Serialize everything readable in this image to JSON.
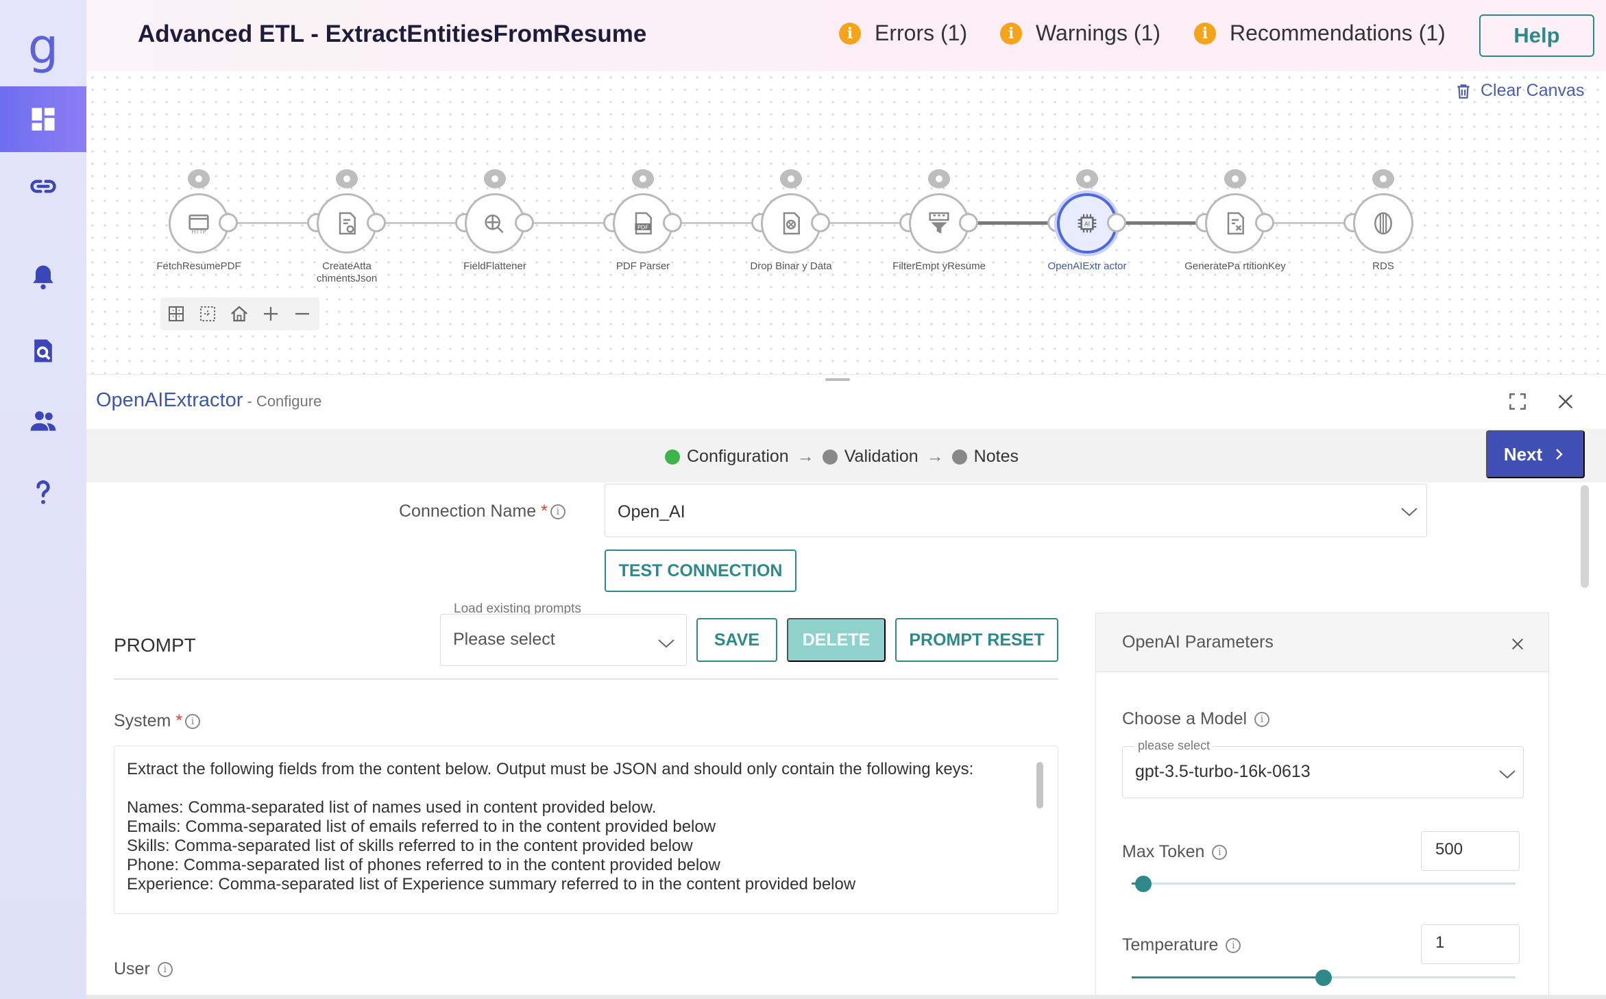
{
  "app": {
    "logo_letter": "g",
    "title": "Advanced ETL - ExtractEntitiesFromResume"
  },
  "sidebar": {
    "items": [
      {
        "icon": "dashboard-icon",
        "active": true
      },
      {
        "icon": "link-icon",
        "active": false
      },
      {
        "icon": "bell-icon",
        "active": false
      },
      {
        "icon": "search-document-icon",
        "active": false
      },
      {
        "icon": "users-icon",
        "active": false
      },
      {
        "icon": "question-icon",
        "active": false
      }
    ]
  },
  "header": {
    "errors": "Errors (1)",
    "warnings": "Warnings (1)",
    "recommendations": "Recommendations (1)",
    "help_label": "Help",
    "issue_icon_glyph": "i"
  },
  "canvas": {
    "clear_label": "Clear Canvas",
    "nodes": [
      {
        "label": "FetchResumePDF",
        "icon": "http-icon"
      },
      {
        "label": "CreateAtta chmentsJson",
        "icon": "document-gear-icon"
      },
      {
        "label": "FieldFlattener",
        "icon": "flatten-icon"
      },
      {
        "label": "PDF Parser",
        "icon": "pdf-icon"
      },
      {
        "label": "Drop Binar y Data",
        "icon": "drop-file-icon"
      },
      {
        "label": "FilterEmpt yResume",
        "icon": "filter-icon"
      },
      {
        "label": "OpenAIExtr actor",
        "icon": "ai-chip-icon",
        "active": true
      },
      {
        "label": "GeneratePa rtitionKey",
        "icon": "document-key-icon"
      },
      {
        "label": "RDS",
        "icon": "database-icon"
      }
    ]
  },
  "panel": {
    "title": "OpenAIExtractor",
    "subtitle": " - Configure",
    "steps": [
      {
        "label": "Configuration",
        "done": true
      },
      {
        "label": "Validation",
        "done": false
      },
      {
        "label": "Notes",
        "done": false
      }
    ],
    "step_arrow": "→",
    "next_label": "Next"
  },
  "form": {
    "connection_label": "Connection Name",
    "required_mark": "*",
    "connection_value": "Open_AI",
    "test_connection_label": "TEST CONNECTION",
    "prompt_heading": "PROMPT",
    "load_prompts_label": "Load existing prompts",
    "load_prompts_value": "Please select",
    "save_label": "SAVE",
    "delete_label": "DELETE",
    "prompt_reset_label": "PROMPT RESET",
    "system_label": "System",
    "system_text": "Extract the following fields from the content below. Output must be JSON and should only contain the following keys:\n\nNames: Comma-separated list of names used in content provided below.\nEmails: Comma-separated list of emails referred to in the content provided below\nSkills: Comma-separated list of skills referred to in the content provided below\nPhone: Comma-separated list of phones referred to in the content provided below\nExperience: Comma-separated list of Experience summary referred to in the content provided below",
    "user_label": "User"
  },
  "params": {
    "title": "OpenAI Parameters",
    "model_label": "Choose a Model",
    "model_placeholder": "please select",
    "model_value": "gpt-3.5-turbo-16k-0613",
    "max_token_label": "Max Token",
    "max_token_value": "500",
    "max_token_fraction": 0.03,
    "temperature_label": "Temperature",
    "temperature_value": "1",
    "temperature_fraction": 0.5
  },
  "colors": {
    "accent": "#2e8a8a",
    "primary": "#3f4fb3",
    "sidebar_active": "#6e6ef0",
    "warning": "#f5a31a"
  }
}
